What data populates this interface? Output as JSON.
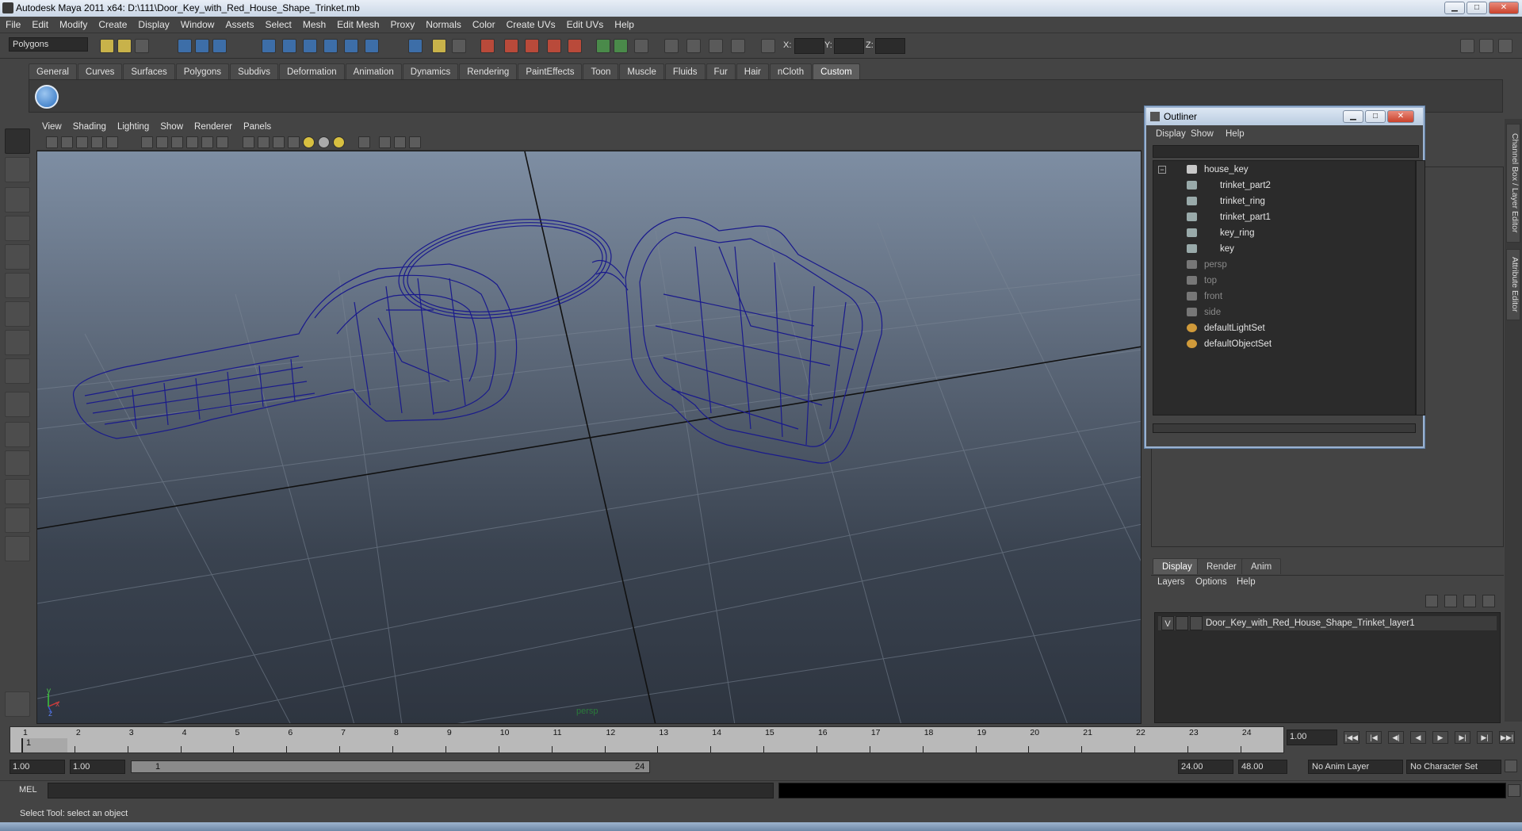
{
  "window": {
    "title": "Autodesk Maya 2011 x64: D:\\111\\Door_Key_with_Red_House_Shape_Trinket.mb",
    "minimize_label": "▁",
    "maximize_label": "□",
    "close_label": "✕"
  },
  "menubar": [
    "File",
    "Edit",
    "Modify",
    "Create",
    "Display",
    "Window",
    "Assets",
    "Select",
    "Mesh",
    "Edit Mesh",
    "Proxy",
    "Normals",
    "Color",
    "Create UVs",
    "Edit UVs",
    "Help"
  ],
  "statusline": {
    "mode": "Polygons",
    "x_label": "X:",
    "y_label": "Y:",
    "z_label": "Z:",
    "x_value": "",
    "y_value": "",
    "z_value": ""
  },
  "shelf": {
    "tabs": [
      "General",
      "Curves",
      "Surfaces",
      "Polygons",
      "Subdivs",
      "Deformation",
      "Animation",
      "Dynamics",
      "Rendering",
      "PaintEffects",
      "Toon",
      "Muscle",
      "Fluids",
      "Fur",
      "Hair",
      "nCloth",
      "Custom"
    ],
    "active_tab": "Custom"
  },
  "viewport": {
    "menu": [
      "View",
      "Shading",
      "Lighting",
      "Show",
      "Renderer",
      "Panels"
    ],
    "camera_label": "persp",
    "axis_x": "x",
    "axis_y": "y",
    "axis_z": "z",
    "wire_color": "#1a1a8c"
  },
  "outliner": {
    "title": "Outliner",
    "menu": [
      "Display",
      "Show",
      "Help"
    ],
    "collapse_glyph": "−",
    "items": [
      {
        "label": "house_key",
        "depth": 0,
        "dim": false,
        "icon": "transform-icon"
      },
      {
        "label": "trinket_part2",
        "depth": 1,
        "dim": false,
        "icon": "mesh-icon"
      },
      {
        "label": "trinket_ring",
        "depth": 1,
        "dim": false,
        "icon": "mesh-icon"
      },
      {
        "label": "trinket_part1",
        "depth": 1,
        "dim": false,
        "icon": "mesh-icon"
      },
      {
        "label": "key_ring",
        "depth": 1,
        "dim": false,
        "icon": "mesh-icon"
      },
      {
        "label": "key",
        "depth": 1,
        "dim": false,
        "icon": "mesh-icon"
      },
      {
        "label": "persp",
        "depth": 0,
        "dim": true,
        "icon": "camera-icon"
      },
      {
        "label": "top",
        "depth": 0,
        "dim": true,
        "icon": "camera-icon"
      },
      {
        "label": "front",
        "depth": 0,
        "dim": true,
        "icon": "camera-icon"
      },
      {
        "label": "side",
        "depth": 0,
        "dim": true,
        "icon": "camera-icon"
      },
      {
        "label": "defaultLightSet",
        "depth": 0,
        "dim": false,
        "icon": "set-icon"
      },
      {
        "label": "defaultObjectSet",
        "depth": 0,
        "dim": false,
        "icon": "set-icon"
      }
    ]
  },
  "sidetabs": [
    "Channel Box / Layer Editor",
    "Attribute Editor"
  ],
  "layer_panel": {
    "tabs": [
      "Display",
      "Render",
      "Anim"
    ],
    "active_tab": "Display",
    "menu": [
      "Layers",
      "Options",
      "Help"
    ],
    "layers": [
      {
        "visible": "V",
        "name": "Door_Key_with_Red_House_Shape_Trinket_layer1"
      }
    ]
  },
  "timeline": {
    "ticks": [
      "1",
      "2",
      "3",
      "4",
      "5",
      "6",
      "7",
      "8",
      "9",
      "10",
      "11",
      "12",
      "13",
      "14",
      "15",
      "16",
      "17",
      "18",
      "19",
      "20",
      "21",
      "22",
      "23",
      "24"
    ],
    "current_frame_marker": "1",
    "current_time": "1.00"
  },
  "range": {
    "start": "1.00",
    "playback_start": "1.00",
    "bar_start": "1",
    "bar_end": "24",
    "playback_end": "24.00",
    "end": "48.00",
    "anim_layer": "No Anim Layer",
    "character_set": "No Character Set"
  },
  "playback": [
    "|◀◀",
    "|◀",
    "◀|",
    "◀",
    "▶",
    "▶|",
    "▶|",
    "▶▶|"
  ],
  "command": {
    "language": "MEL",
    "input": ""
  },
  "help_line": "Select Tool: select an object"
}
